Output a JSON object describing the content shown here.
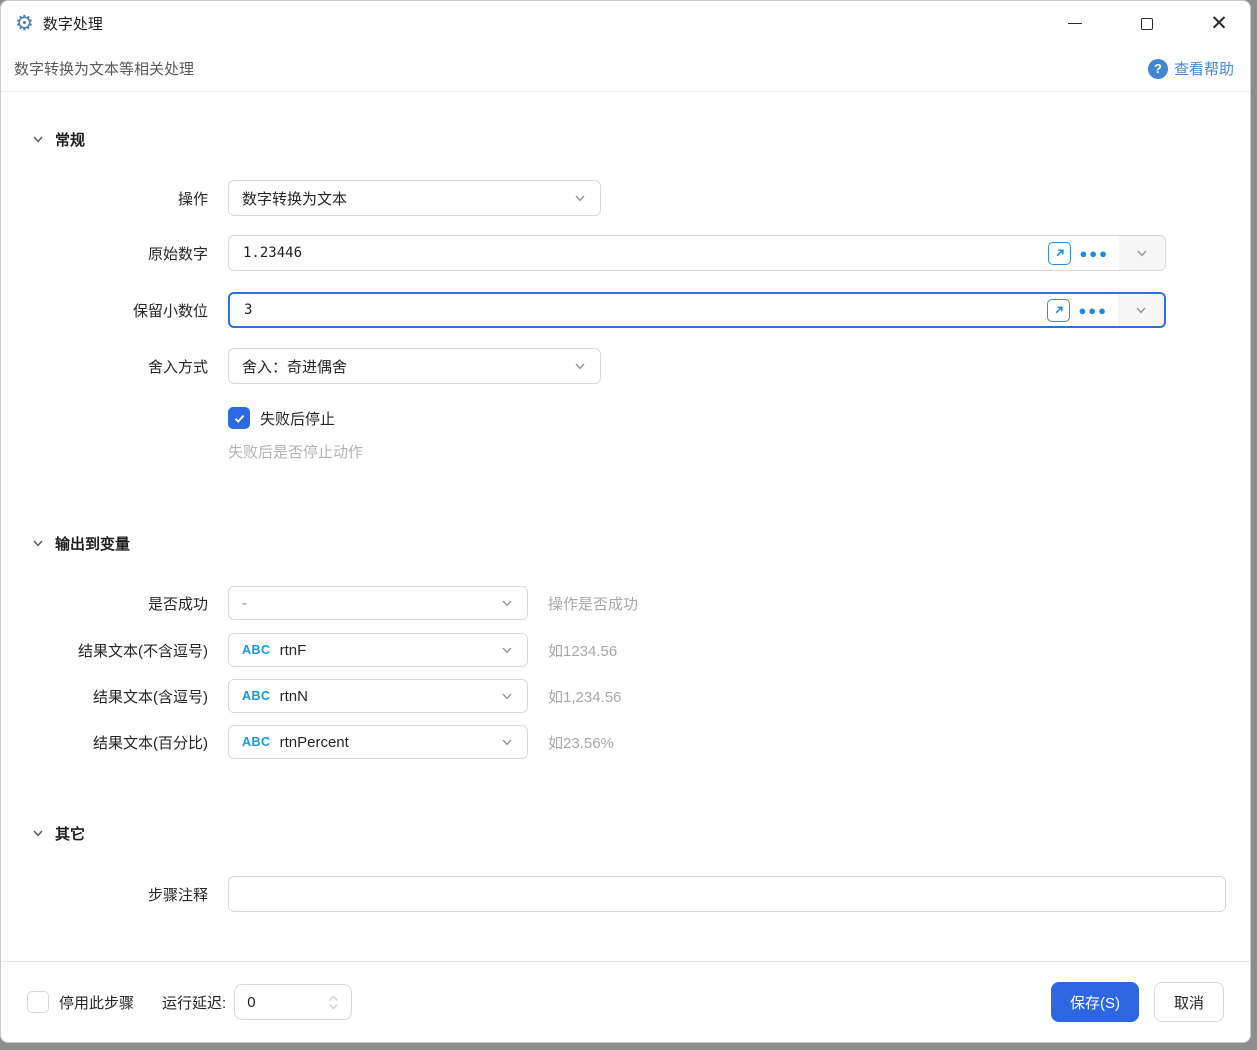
{
  "window": {
    "title": "数字处理",
    "subtitle": "数字转换为文本等相关处理",
    "help_label": "查看帮助",
    "help_glyph": "?"
  },
  "colors": {
    "accent_blue": "#2c66e1",
    "icon_blue": "#1e88e5",
    "help_blue": "#4286d3",
    "gear_blue": "#4a80b4",
    "focus_border": "#2f6fe4",
    "hint_gray": "#b3b3b3"
  },
  "general": {
    "title": "常规",
    "operation": {
      "label": "操作",
      "value": "数字转换为文本"
    },
    "source_number": {
      "label": "原始数字",
      "value": "1.23446"
    },
    "decimal_places": {
      "label": "保留小数位",
      "value": "3"
    },
    "rounding": {
      "label": "舍入方式",
      "value": "舍入：奇进偶舍"
    },
    "stop_on_fail": {
      "label": "失败后停止",
      "checked": true,
      "hint": "失败后是否停止动作"
    }
  },
  "output": {
    "title": "输出到变量",
    "rows": [
      {
        "label": "是否成功",
        "value": "-",
        "hint": "操作是否成功",
        "type_tag": ""
      },
      {
        "label": "结果文本(不含逗号)",
        "value": "rtnF",
        "hint": "如1234.56",
        "type_tag": "ABC"
      },
      {
        "label": "结果文本(含逗号)",
        "value": "rtnN",
        "hint": "如1,234.56",
        "type_tag": "ABC"
      },
      {
        "label": "结果文本(百分比)",
        "value": "rtnPercent",
        "hint": "如23.56%",
        "type_tag": "ABC"
      }
    ]
  },
  "other": {
    "title": "其它",
    "comment": {
      "label": "步骤注释",
      "value": ""
    }
  },
  "footer": {
    "disable_label": "停用此步骤",
    "disable_checked": false,
    "delay_label": "运行延迟:",
    "delay_value": "0",
    "save_label": "保存(S)",
    "cancel_label": "取消"
  }
}
